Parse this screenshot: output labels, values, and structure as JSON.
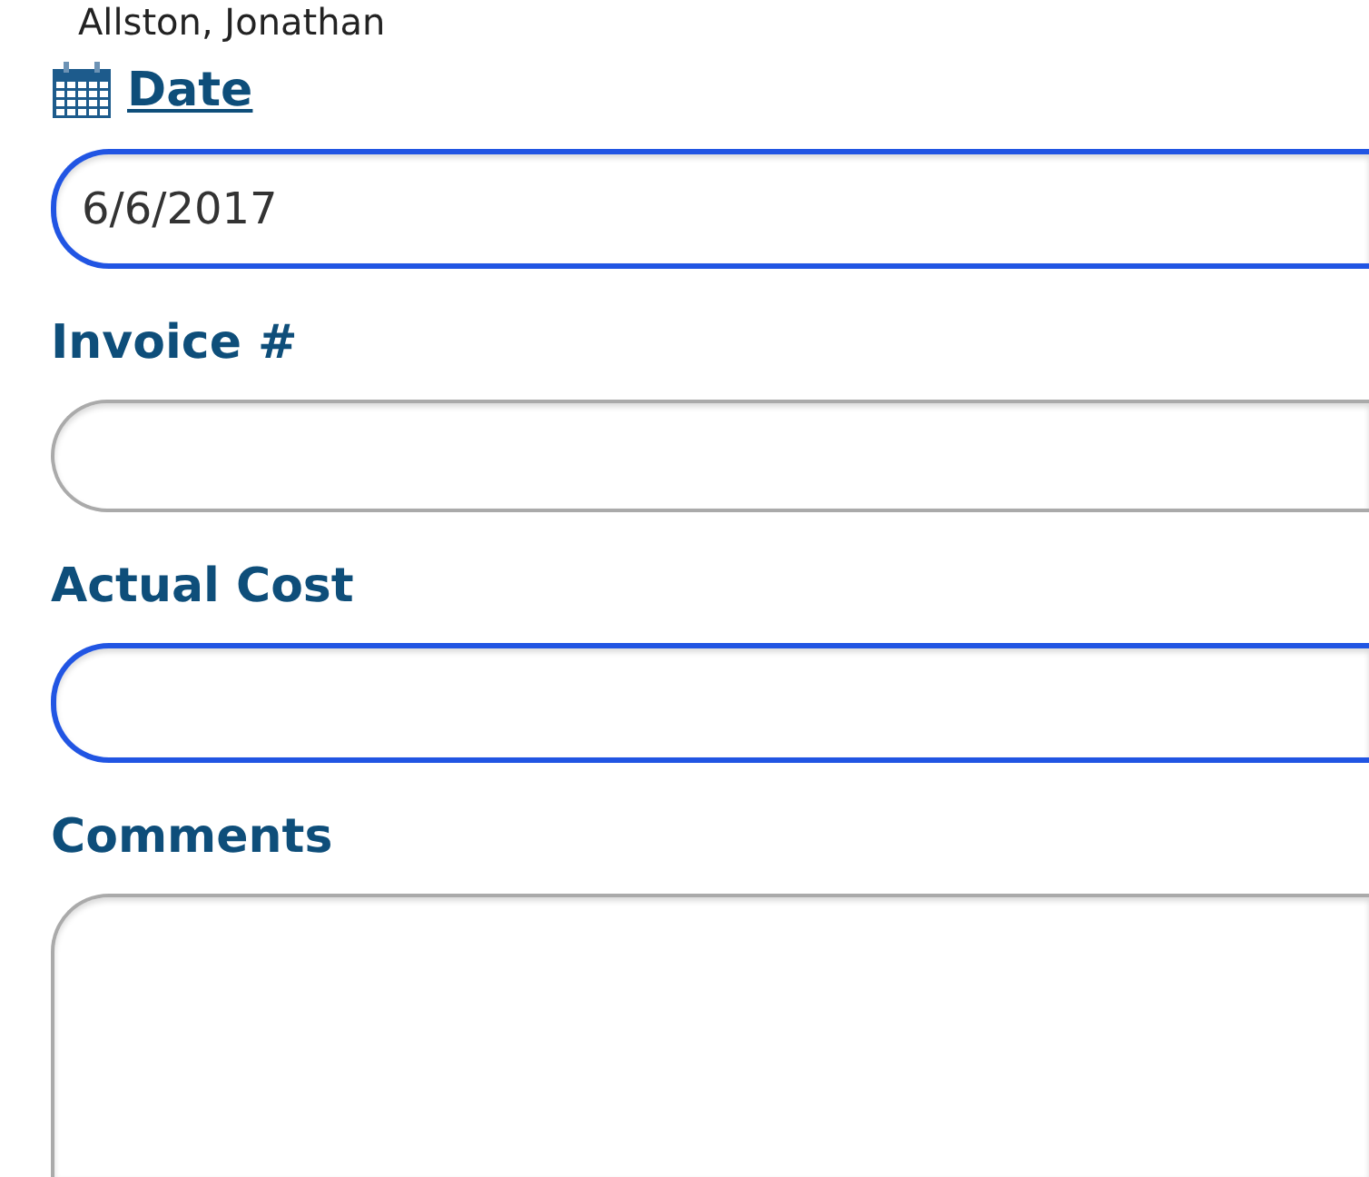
{
  "assignee": "Allston, Jonathan",
  "fields": [
    {
      "kind": "date",
      "label": "Date",
      "value": "6/6/2017",
      "highlighted": true
    },
    {
      "kind": "text",
      "label": "Invoice #",
      "highlighted": false
    },
    {
      "kind": "text",
      "label": "Actual Cost",
      "highlighted": true
    },
    {
      "kind": "textarea",
      "label": "Comments",
      "highlighted": false
    }
  ]
}
